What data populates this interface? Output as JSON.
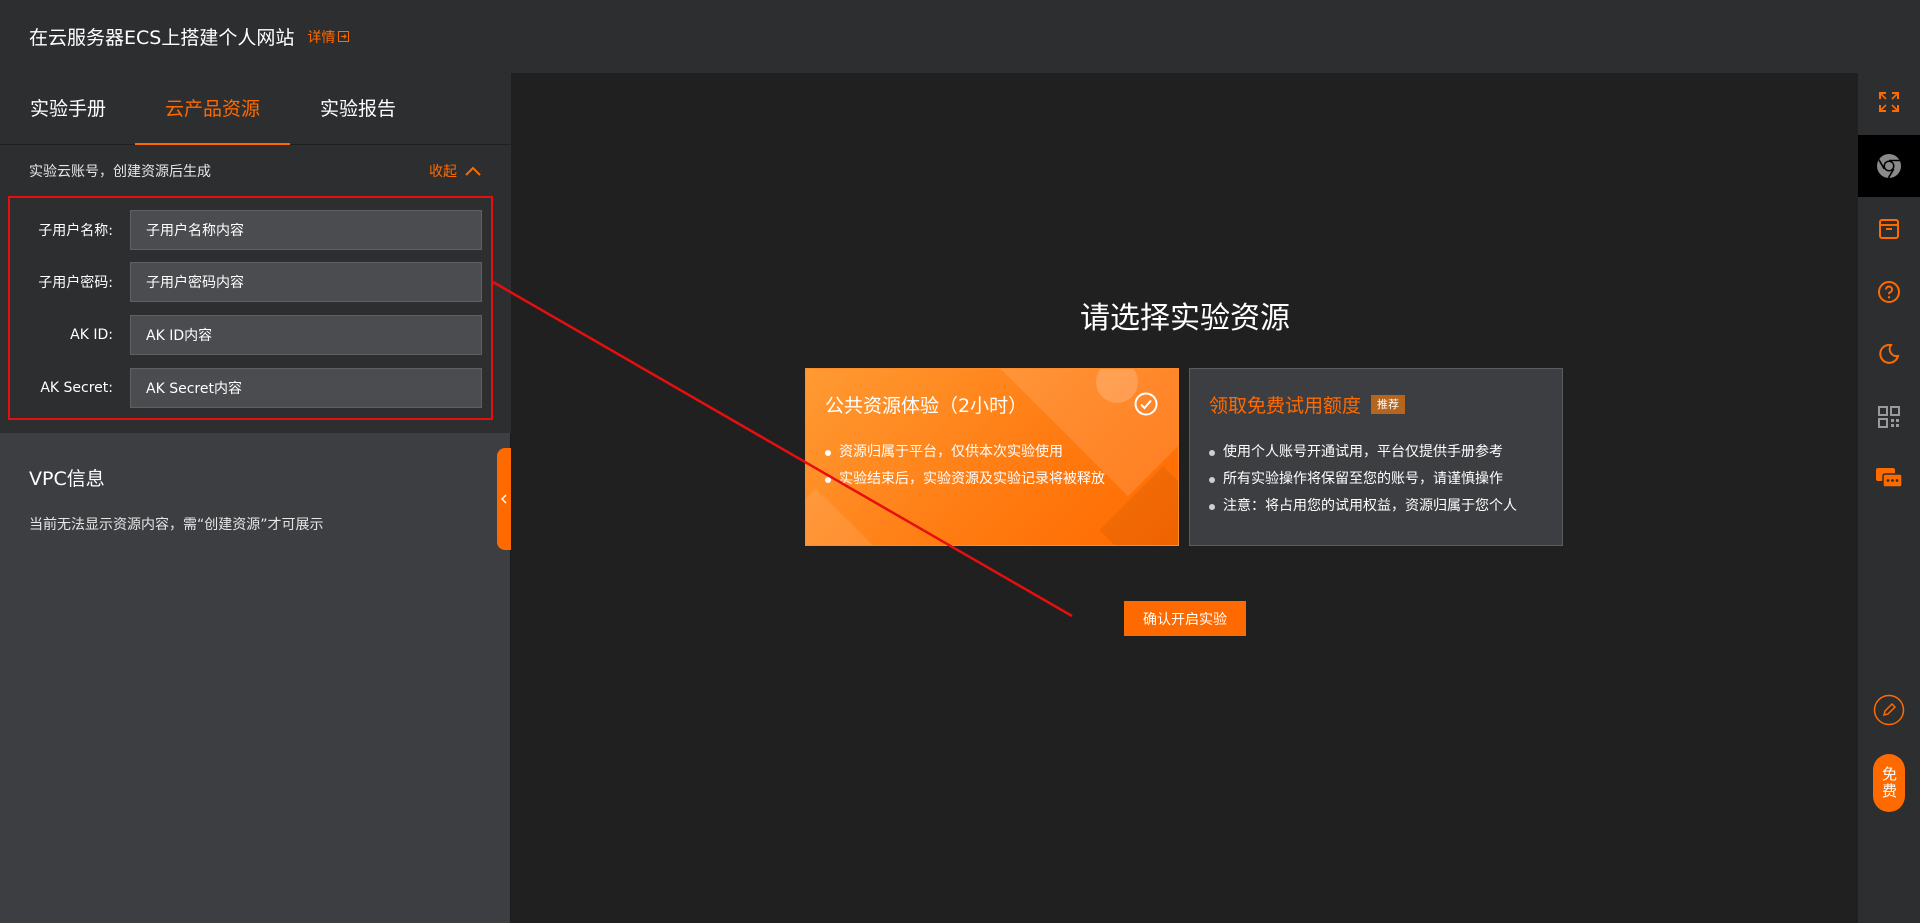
{
  "header": {
    "title": "在云服务器ECS上搭建个人网站",
    "detail_link": "详情"
  },
  "left_panel": {
    "tabs": [
      {
        "label": "实验手册",
        "active": false
      },
      {
        "label": "云产品资源",
        "active": true
      },
      {
        "label": "实验报告",
        "active": false
      }
    ],
    "account": {
      "hint": "实验云账号，创建资源后生成",
      "collapse_label": "收起",
      "fields": [
        {
          "label": "子用户名称:",
          "value": "子用户名称内容"
        },
        {
          "label": "子用户密码:",
          "value": "子用户密码内容"
        },
        {
          "label": "AK ID:",
          "value": "AK ID内容"
        },
        {
          "label": "AK Secret:",
          "value": "AK Secret内容"
        }
      ]
    },
    "vpc": {
      "title": "VPC信息",
      "text": "当前无法显示资源内容，需“创建资源”才可展示"
    }
  },
  "main": {
    "title": "请选择实验资源",
    "cards": [
      {
        "title": "公共资源体验（2小时）",
        "selected": true,
        "bullets": [
          "资源归属于平台，仅供本次实验使用",
          "实验结束后，实验资源及实验记录将被释放"
        ]
      },
      {
        "title": "领取免费试用额度",
        "badge": "推荐",
        "selected": false,
        "bullets": [
          "使用个人账号开通试用，平台仅提供手册参考",
          "所有实验操作将保留至您的账号，请谨慎操作",
          "注意：将占用您的试用权益，资源归属于您个人"
        ]
      }
    ],
    "confirm_button": "确认开启实验"
  },
  "right_rail": {
    "items": [
      "fullscreen-icon",
      "chrome-icon",
      "archive-icon",
      "help-icon",
      "moon-icon",
      "qrcode-icon",
      "chat-icon",
      "edit-icon"
    ],
    "free_button": "免费"
  },
  "colors": {
    "accent": "#ff6a00",
    "annotation": "#e60f0f"
  }
}
